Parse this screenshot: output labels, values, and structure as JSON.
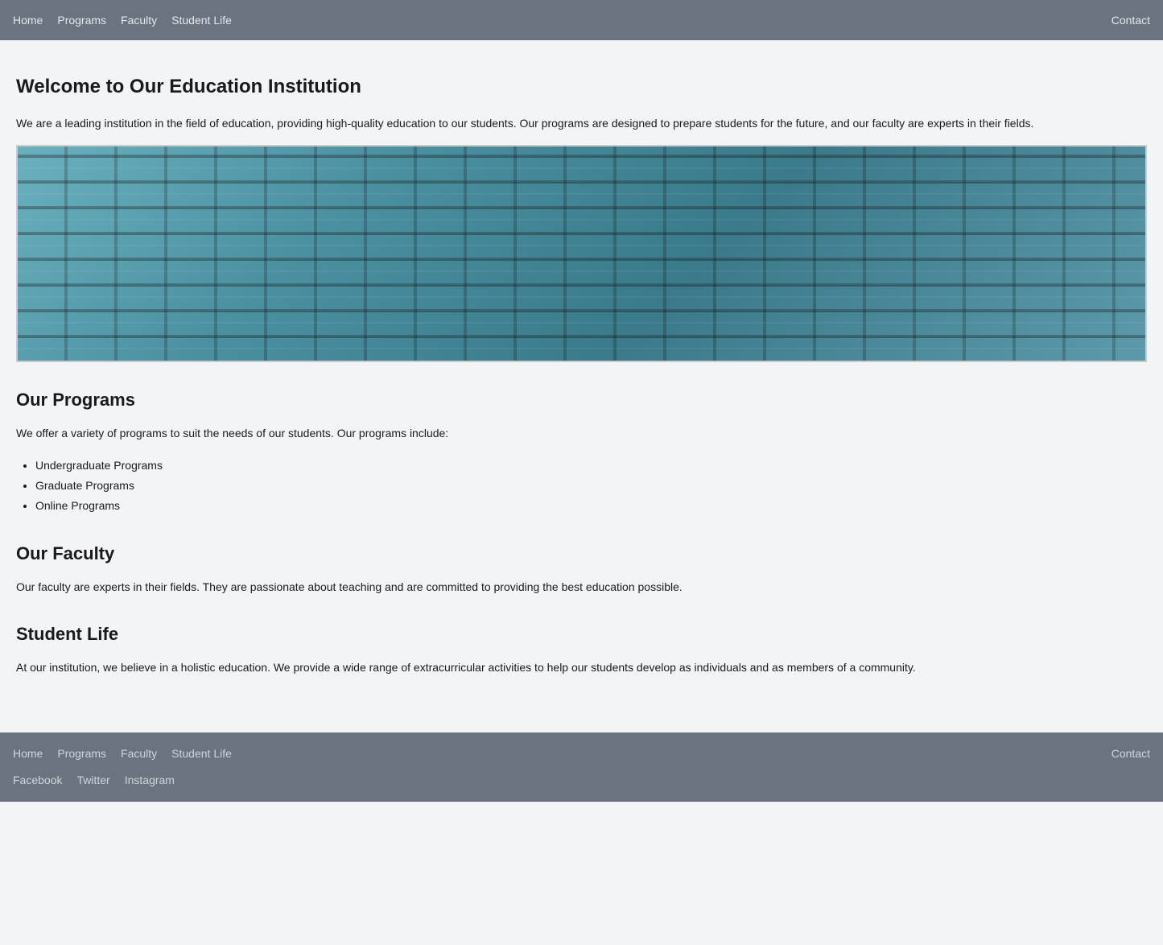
{
  "nav": {
    "left_links": [
      {
        "label": "Home",
        "href": "#"
      },
      {
        "label": "Programs",
        "href": "#"
      },
      {
        "label": "Faculty",
        "href": "#"
      },
      {
        "label": "Student Life",
        "href": "#"
      }
    ],
    "right_links": [
      {
        "label": "Contact",
        "href": "#"
      }
    ]
  },
  "hero": {
    "title": "Welcome to Our Education Institution",
    "description": "We are a leading institution in the field of education, providing high-quality education to our students. Our programs are designed to prepare students for the future, and our faculty are experts in their fields."
  },
  "programs": {
    "title": "Our Programs",
    "intro": "We offer a variety of programs to suit the needs of our students. Our programs include:",
    "items": [
      "Undergraduate Programs",
      "Graduate Programs",
      "Online Programs"
    ]
  },
  "faculty": {
    "title": "Our Faculty",
    "description": "Our faculty are experts in their fields. They are passionate about teaching and are committed to providing the best education possible."
  },
  "student_life": {
    "title": "Student Life",
    "description": "At our institution, we believe in a holistic education. We provide a wide range of extracurricular activities to help our students develop as individuals and as members of a community."
  },
  "footer": {
    "nav_left": [
      {
        "label": "Home"
      },
      {
        "label": "Programs"
      },
      {
        "label": "Faculty"
      },
      {
        "label": "Student Life"
      }
    ],
    "nav_right": [
      {
        "label": "Contact"
      }
    ],
    "social": [
      {
        "label": "Facebook"
      },
      {
        "label": "Twitter"
      },
      {
        "label": "Instagram"
      }
    ]
  }
}
